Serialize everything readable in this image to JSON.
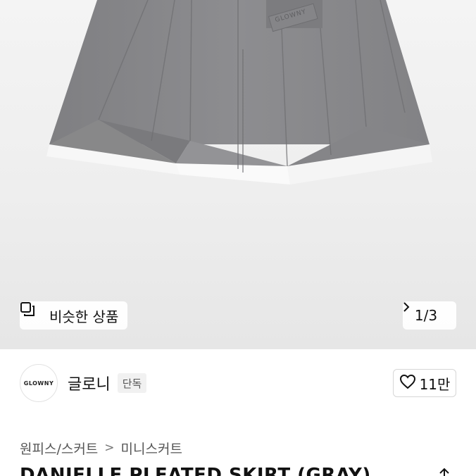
{
  "product_image": {
    "label_tag_text": "GLOWNY"
  },
  "similar_button": {
    "label": "비슷한 상품",
    "icon": "similar-items-icon"
  },
  "image_counter": {
    "text": "1/3",
    "icon": "chevron-right-icon"
  },
  "brand": {
    "logo_text": "GLOWNY",
    "name": "글로니",
    "badge": "단독"
  },
  "like": {
    "count": "11만",
    "icon": "heart-icon"
  },
  "breadcrumb": {
    "items": [
      "원피스/스커트",
      "미니스커트"
    ],
    "separator": ">"
  },
  "product": {
    "title": "DANIELLE PLEATED SKIRT (GRAY)"
  },
  "colors": {
    "skirt_gray": "#8a8a8c",
    "hem_white": "#f8f8f8",
    "background": "#eeeeee"
  }
}
